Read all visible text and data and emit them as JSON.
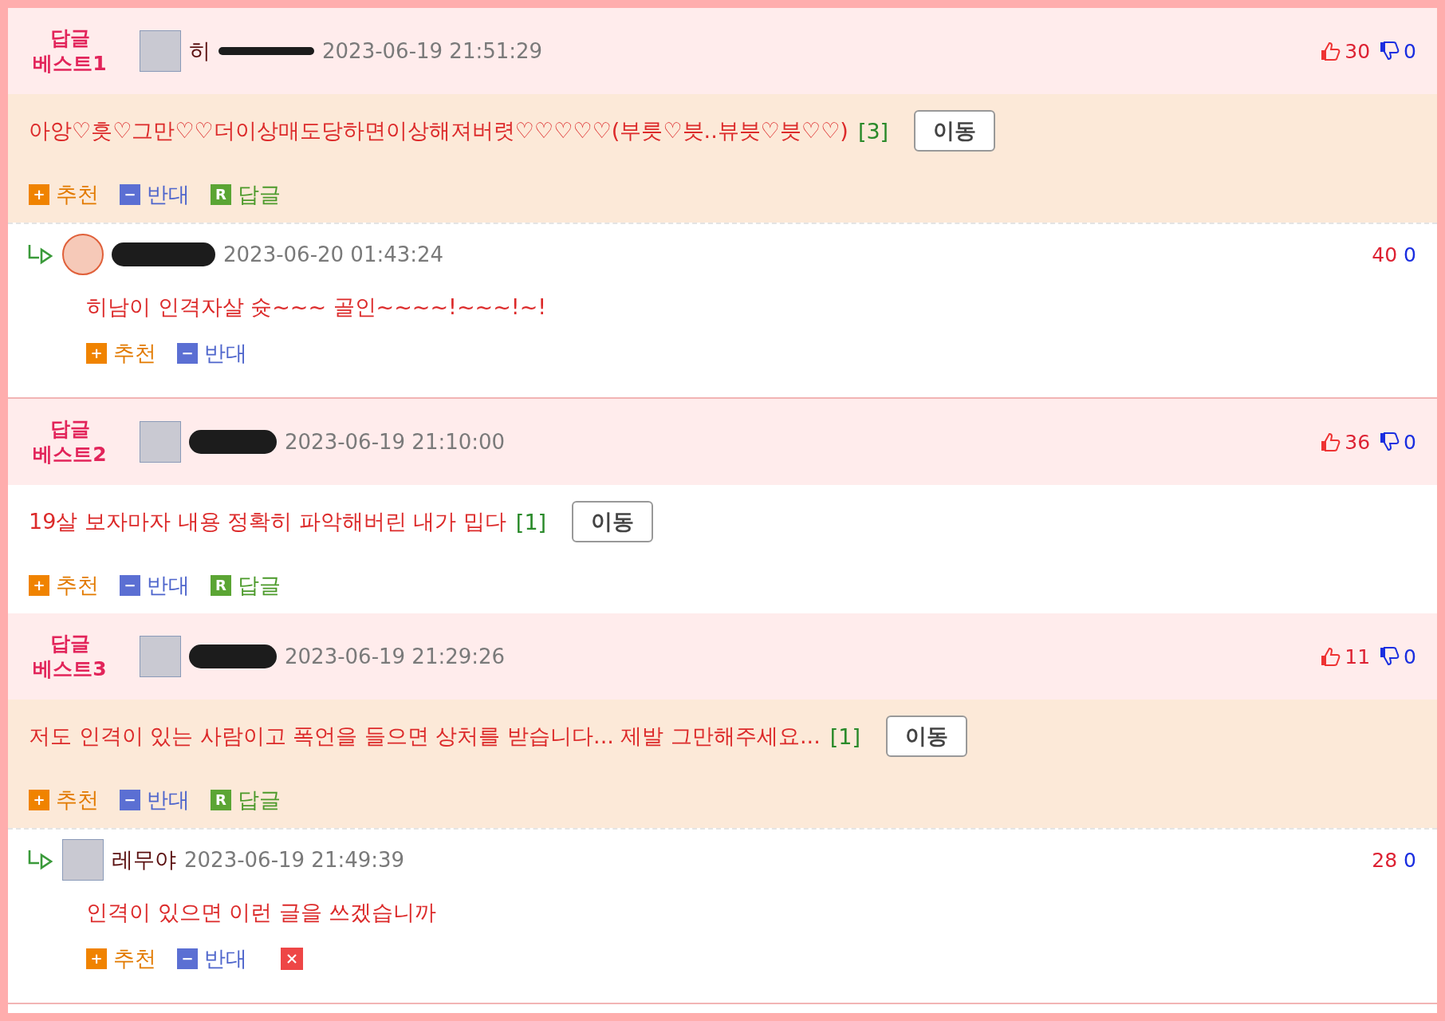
{
  "comments": [
    {
      "kind": "best",
      "badge_top": "답글",
      "badge_bottom": "베스트1",
      "avatar_round": false,
      "author": "히",
      "name_scribbled": true,
      "date": "2023-06-19 21:51:29",
      "up": "30",
      "down": "0",
      "text": "아앙♡흣♡그만♡♡더이상매도당하면이상해져버렷♡♡♡♡♡(부릇♡븟..뷰븟♡븟♡♡)",
      "reply_count": "[3]",
      "move_label": "이동",
      "highlighted": true,
      "actions": [
        {
          "kind": "up",
          "glyph": "+",
          "label": "추천"
        },
        {
          "kind": "down",
          "glyph": "−",
          "label": "반대"
        },
        {
          "kind": "reply",
          "glyph": "R",
          "label": "답글"
        }
      ]
    },
    {
      "kind": "reply",
      "avatar_round": true,
      "name_scribbled": true,
      "date": "2023-06-20 01:43:24",
      "up": "40",
      "down": "0",
      "text": "히남이 인격자살 슛~~~ 골인~~~~!~~~!~!",
      "actions": [
        {
          "kind": "up",
          "glyph": "+",
          "label": "추천"
        },
        {
          "kind": "down",
          "glyph": "−",
          "label": "반대"
        }
      ]
    },
    {
      "kind": "best",
      "badge_top": "답글",
      "badge_bottom": "베스트2",
      "avatar_round": false,
      "name_scribbled": true,
      "date": "2023-06-19 21:10:00",
      "up": "36",
      "down": "0",
      "text": "19살 보자마자 내용 정확히 파악해버린 내가 밉다",
      "reply_count": "[1]",
      "move_label": "이동",
      "highlighted": false,
      "actions": [
        {
          "kind": "up",
          "glyph": "+",
          "label": "추천"
        },
        {
          "kind": "down",
          "glyph": "−",
          "label": "반대"
        },
        {
          "kind": "reply",
          "glyph": "R",
          "label": "답글"
        }
      ]
    },
    {
      "kind": "best",
      "badge_top": "답글",
      "badge_bottom": "베스트3",
      "avatar_round": false,
      "name_scribbled": true,
      "date": "2023-06-19 21:29:26",
      "up": "11",
      "down": "0",
      "text": "저도 인격이 있는 사람이고 폭언을 들으면 상처를 받습니다... 제발 그만해주세요...",
      "reply_count": "[1]",
      "move_label": "이동",
      "highlighted": true,
      "actions": [
        {
          "kind": "up",
          "glyph": "+",
          "label": "추천"
        },
        {
          "kind": "down",
          "glyph": "−",
          "label": "반대"
        },
        {
          "kind": "reply",
          "glyph": "R",
          "label": "답글"
        }
      ]
    },
    {
      "kind": "reply",
      "avatar_round": false,
      "author": "레무야",
      "name_scribbled": false,
      "date": "2023-06-19 21:49:39",
      "up": "28",
      "down": "0",
      "text": "인격이 있으면 이런 글을 쓰겠습니까",
      "actions": [
        {
          "kind": "up",
          "glyph": "+",
          "label": "추천"
        },
        {
          "kind": "down",
          "glyph": "−",
          "label": "반대"
        },
        {
          "kind": "delete"
        }
      ]
    }
  ]
}
